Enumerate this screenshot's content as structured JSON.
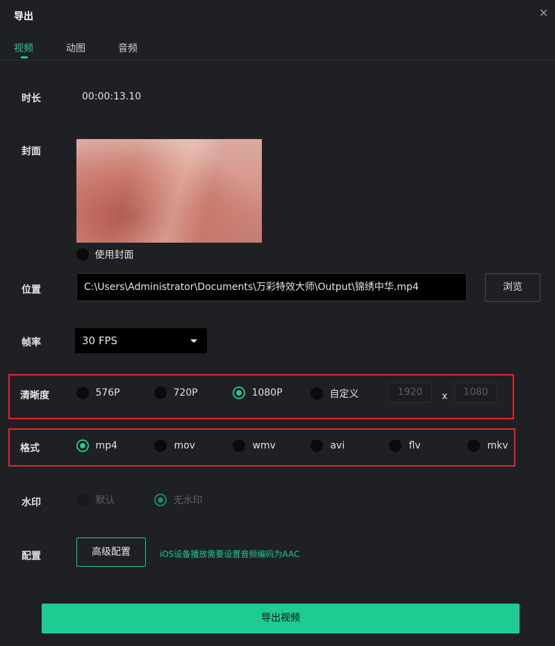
{
  "window": {
    "title": "导出",
    "close_icon": "close-icon"
  },
  "tabs": [
    {
      "label": "视频",
      "active": true
    },
    {
      "label": "动图",
      "active": false
    },
    {
      "label": "音频",
      "active": false
    }
  ],
  "duration": {
    "label": "时长",
    "value": "00:00:13.10"
  },
  "cover": {
    "label": "封面",
    "use_cover_label": "使用封面",
    "use_cover_checked": false
  },
  "location": {
    "label": "位置",
    "path": "C:\\Users\\Administrator\\Documents\\万彩特效大师\\Output\\锦绣中华.mp4",
    "browse_label": "浏览"
  },
  "frame_rate": {
    "label": "帧率",
    "selected": "30 FPS"
  },
  "resolution": {
    "label": "清晰度",
    "options": [
      "576P",
      "720P",
      "1080P",
      "自定义"
    ],
    "selected": "1080P",
    "width_placeholder": "1920",
    "height_placeholder": "1080",
    "separator": "x"
  },
  "format": {
    "label": "格式",
    "options": [
      "mp4",
      "mov",
      "wmv",
      "avi",
      "flv",
      "mkv"
    ],
    "selected": "mp4"
  },
  "watermark": {
    "label": "水印",
    "options": [
      "默认",
      "无水印"
    ],
    "selected": "无水印"
  },
  "config": {
    "label": "配置",
    "advanced_label": "高级配置",
    "hint": "iOS设备播放需要设置音频编码为AAC"
  },
  "export_button": "导出视频",
  "colors": {
    "accent": "#1ecb92",
    "background": "#1f2023",
    "highlight_border": "#e3272d"
  }
}
